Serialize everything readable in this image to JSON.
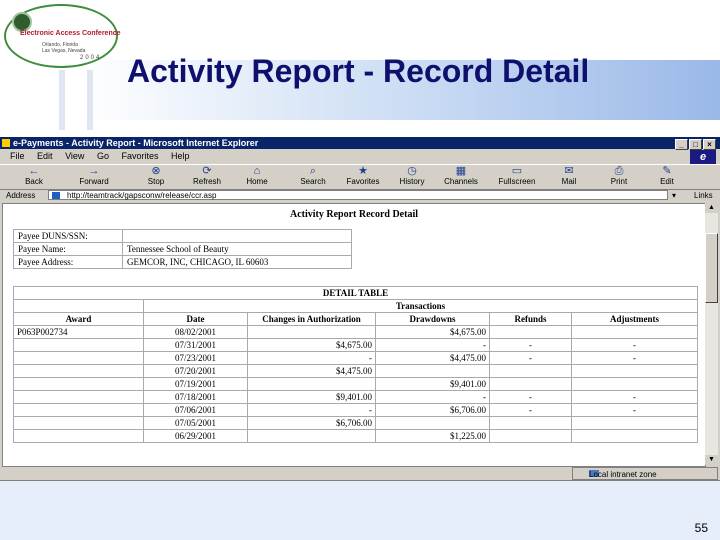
{
  "slide": {
    "title": "Activity Report - Record Detail",
    "page_number": "55",
    "logo": {
      "line1": "Electronic Access Conference",
      "line2": "Orlando, Florida",
      "line3": "Las Vegas, Nevada",
      "year": "2004"
    }
  },
  "browser": {
    "window_title": "e-Payments - Activity Report - Microsoft Internet Explorer",
    "menu": [
      "File",
      "Edit",
      "View",
      "Go",
      "Favorites",
      "Help"
    ],
    "toolbar": [
      {
        "label": "Back",
        "icon": "back-arrow-icon",
        "glyph": "←"
      },
      {
        "label": "Forward",
        "icon": "forward-arrow-icon",
        "glyph": "→"
      },
      {
        "label": "Stop",
        "icon": "stop-icon",
        "glyph": "⊗"
      },
      {
        "label": "Refresh",
        "icon": "refresh-icon",
        "glyph": "⟳"
      },
      {
        "label": "Home",
        "icon": "home-icon",
        "glyph": "⌂"
      },
      {
        "label": "Search",
        "icon": "search-icon",
        "glyph": "⌕"
      },
      {
        "label": "Favorites",
        "icon": "favorites-icon",
        "glyph": "★"
      },
      {
        "label": "History",
        "icon": "history-icon",
        "glyph": "◷"
      },
      {
        "label": "Channels",
        "icon": "channels-icon",
        "glyph": "▦"
      },
      {
        "label": "Fullscreen",
        "icon": "fullscreen-icon",
        "glyph": "▭"
      },
      {
        "label": "Mail",
        "icon": "mail-icon",
        "glyph": "✉"
      },
      {
        "label": "Print",
        "icon": "print-icon",
        "glyph": "⎙"
      },
      {
        "label": "Edit",
        "icon": "edit-icon",
        "glyph": "✎"
      }
    ],
    "address_label": "Address",
    "address_value": "http://teamtrack/gapsconw/release/ccr.asp",
    "links_label": "Links",
    "status_zone": "Local intranet zone"
  },
  "report": {
    "title": "Activity Report   Record Detail",
    "payee": [
      {
        "label": "Payee DUNS/SSN:",
        "value": ""
      },
      {
        "label": "Payee Name:",
        "value": "Tennessee School of Beauty"
      },
      {
        "label": "Payee Address:",
        "value": "GEMCOR, INC, CHICAGO, IL 60603"
      }
    ],
    "detail_table": {
      "caption": "DETAIL TABLE",
      "group_header": "Transactions",
      "columns": [
        "Award",
        "Date",
        "Changes in Authorization",
        "Drawdowns",
        "Refunds",
        "Adjustments"
      ],
      "rows": [
        [
          "P063P002734",
          "08/02/2001",
          "",
          "$4,675.00",
          "",
          ""
        ],
        [
          "",
          "07/31/2001",
          "$4,675.00",
          "-",
          "-",
          "-"
        ],
        [
          "",
          "07/23/2001",
          "-",
          "$4,475.00",
          "-",
          "-"
        ],
        [
          "",
          "07/20/2001",
          "$4,475.00",
          "",
          "",
          ""
        ],
        [
          "",
          "07/19/2001",
          "",
          "$9,401.00",
          "",
          ""
        ],
        [
          "",
          "07/18/2001",
          "$9,401.00",
          "-",
          "-",
          "-"
        ],
        [
          "",
          "07/06/2001",
          "-",
          "$6,706.00",
          "-",
          "-"
        ],
        [
          "",
          "07/05/2001",
          "$6,706.00",
          "",
          "",
          ""
        ],
        [
          "",
          "06/29/2001",
          "",
          "$1,225.00",
          "",
          ""
        ]
      ]
    }
  }
}
